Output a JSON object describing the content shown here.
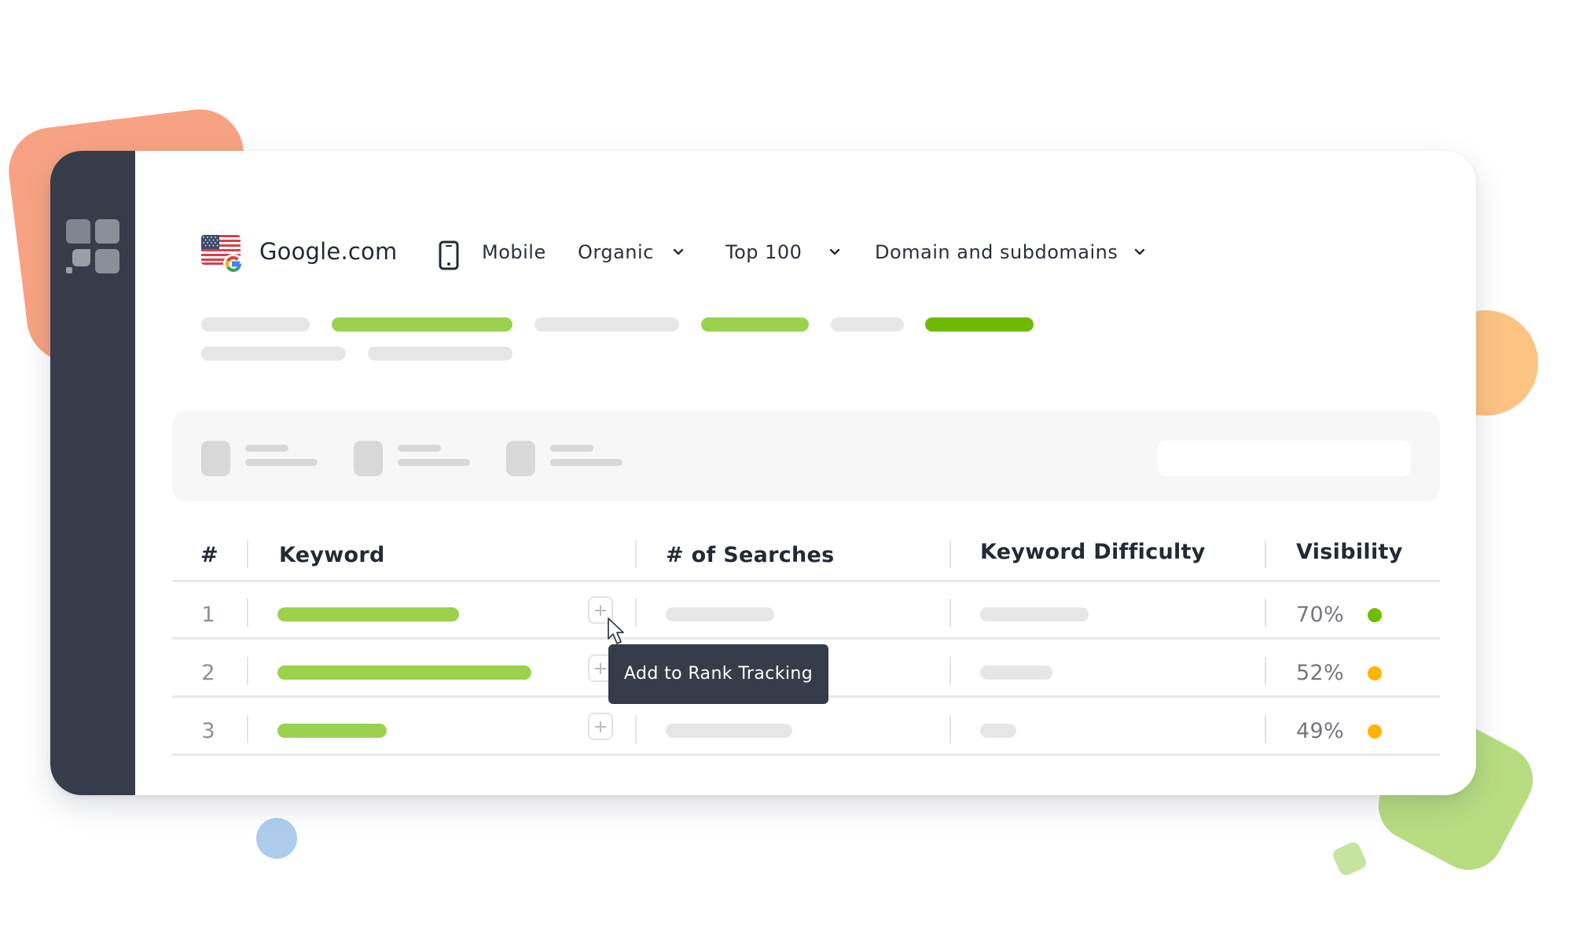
{
  "header": {
    "search_engine": "Google.com",
    "search_engine_flag": "us-flag-google-icon",
    "device_icon": "mobile-phone-icon",
    "device": "Mobile",
    "filters": [
      {
        "label": "Organic",
        "icon": "chevron-down-icon"
      },
      {
        "label": "Top 100",
        "icon": "chevron-down-icon"
      },
      {
        "label": "Domain and subdomains",
        "icon": "chevron-down-icon"
      }
    ]
  },
  "table": {
    "columns": [
      "#",
      "Keyword",
      "# of Searches",
      "Keyword Difficulty",
      "Visibility"
    ],
    "rows": [
      {
        "rank": "1",
        "visibility": "70%",
        "visibility_status_color": "#6fbe00"
      },
      {
        "rank": "2",
        "visibility": "52%",
        "visibility_status_color": "#ffb400"
      },
      {
        "rank": "3",
        "visibility": "49%",
        "visibility_status_color": "#ffb400"
      }
    ],
    "row_action_icon": "plus-icon"
  },
  "tooltip": {
    "text": "Add to Rank Tracking"
  },
  "colors": {
    "sidebar": "#363c4a",
    "accent_green": "#9bd14d",
    "accent_dark_green": "#6fba00",
    "status_green": "#6fbe00",
    "status_amber": "#ffb400"
  }
}
